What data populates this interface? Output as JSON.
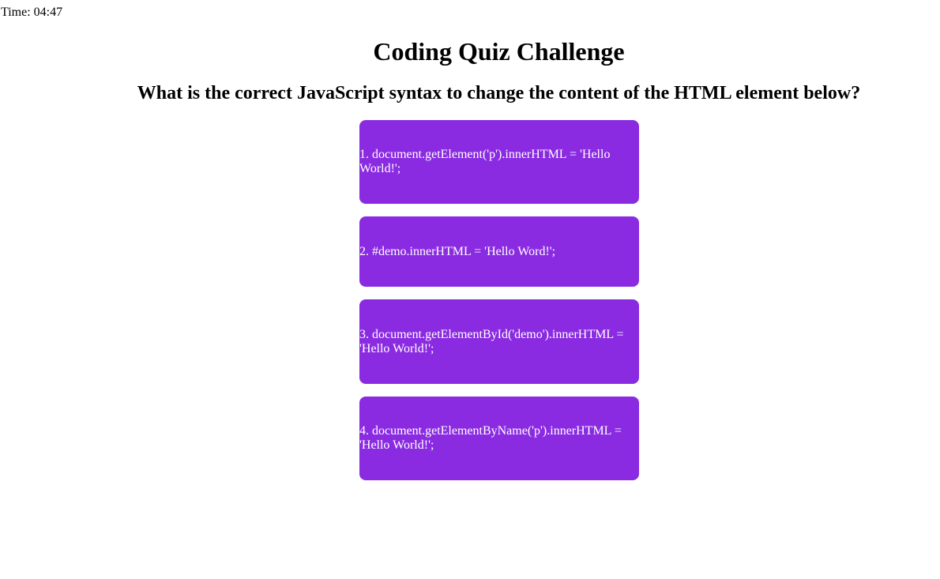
{
  "timer": {
    "text": "Time: 04:47"
  },
  "quiz": {
    "title": "Coding Quiz Challenge",
    "question": "What is the correct JavaScript syntax to change the content of the HTML element below?",
    "answers": [
      "1. document.getElement('p').innerHTML = 'Hello World!';",
      "2. #demo.innerHTML = 'Hello Word!';",
      "3. document.getElementById('demo').innerHTML = 'Hello World!';",
      "4. document.getElementByName('p').innerHTML = 'Hello World!';"
    ]
  },
  "colors": {
    "answer_background": "#8a2be2",
    "answer_text": "#ffffff"
  }
}
